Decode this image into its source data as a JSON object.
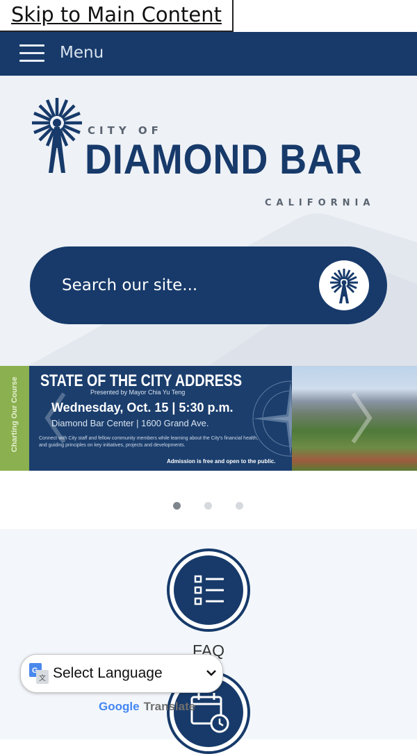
{
  "skip_link": {
    "label": "Skip to Main Content"
  },
  "menu": {
    "label": "Menu"
  },
  "logo": {
    "line1": "CITY OF",
    "line2": "DIAMOND BAR",
    "line3": "CALIFORNIA"
  },
  "search": {
    "placeholder": "Search our site..."
  },
  "banner": {
    "side_text": "Charting Our Course",
    "title": "STATE OF THE CITY ADDRESS",
    "presenter": "Presented by Mayor Chia Yu Teng",
    "datetime": "Wednesday, Oct. 15 | 5:30 p.m.",
    "location": "Diamond Bar Center | 1600 Grand Ave.",
    "description": "Connect with City staff and fellow community members while learning about the City's financial health, and guiding principles on key initiatives, projects and developments.",
    "admission": "Admission is free and open to the public."
  },
  "carousel": {
    "count": 3,
    "active_index": 0
  },
  "quick_links": [
    {
      "label": "FAQ",
      "icon": "list-icon"
    },
    {
      "label": "",
      "icon": "calendar-clock-icon"
    }
  ],
  "translate": {
    "select_label": "Select Language",
    "powered_google": "Google",
    "powered_translate": "Translate"
  },
  "colors": {
    "navy": "#173a6a",
    "hero_bg": "#eef1f6",
    "accent_green": "#8bb04f"
  }
}
